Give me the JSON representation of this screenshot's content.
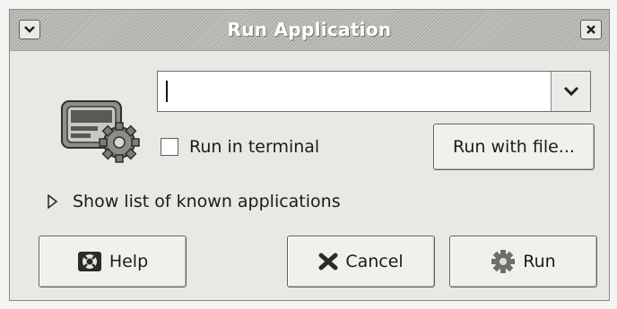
{
  "window": {
    "title": "Run Application",
    "menu_icon": "chevron-down-icon",
    "close_icon": "close-icon"
  },
  "app_icon": "run-application-icon",
  "command": {
    "value": "",
    "dropdown_icon": "chevron-down-icon"
  },
  "run_in_terminal": {
    "label": "Run in terminal",
    "checked": false
  },
  "buttons": {
    "run_with_file": "Run with file...",
    "help": "Help",
    "cancel": "Cancel",
    "run": "Run"
  },
  "known_apps": {
    "label": "Show list of known applications",
    "expanded": false
  },
  "icons": {
    "help": "help-icon",
    "cancel": "cancel-icon",
    "run": "gear-icon",
    "expander": "triangle-right-icon"
  }
}
